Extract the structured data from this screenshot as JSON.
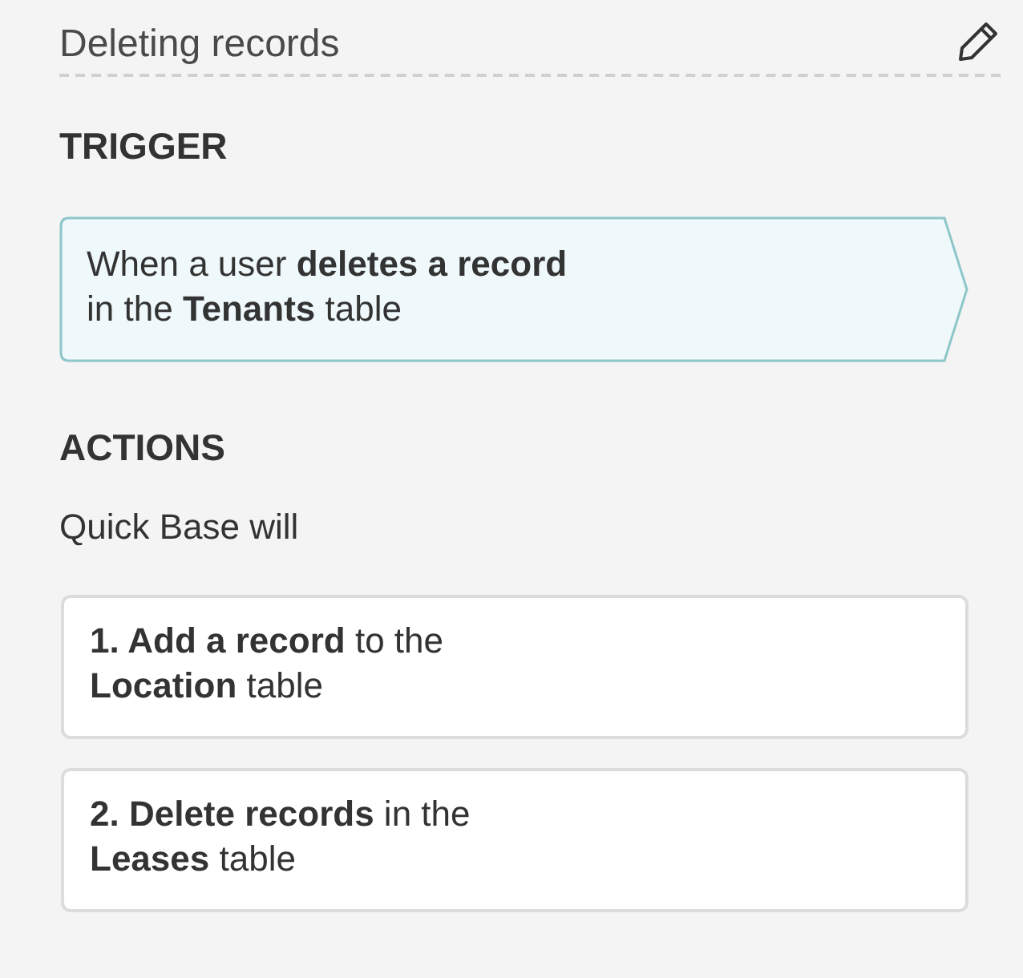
{
  "title": "Deleting records",
  "trigger": {
    "heading": "TRIGGER",
    "lines": [
      "When a user **deletes a record**",
      "in the **Tenants** table"
    ]
  },
  "actions": {
    "heading": "ACTIONS",
    "intro": "Quick Base will",
    "items": [
      {
        "lines": [
          "**1. Add a record** to the",
          "**Location** table"
        ]
      },
      {
        "lines": [
          "**2. Delete records** in the",
          "**Leases** table"
        ]
      }
    ]
  }
}
